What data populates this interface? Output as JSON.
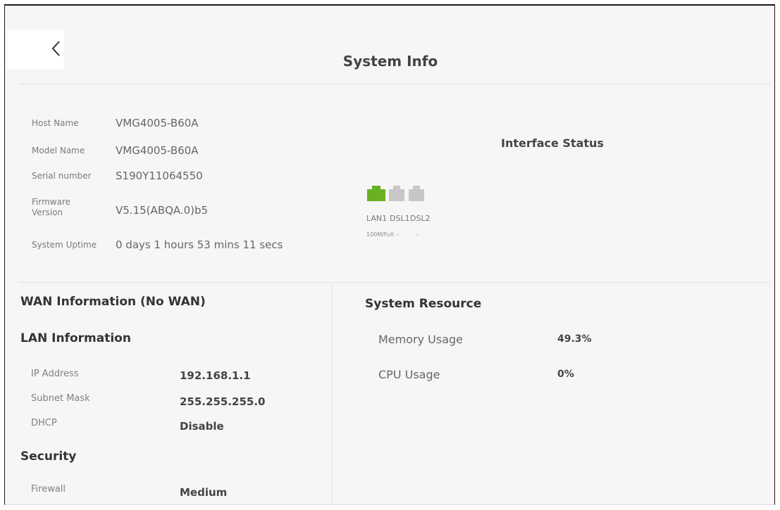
{
  "page": {
    "title": "System Info"
  },
  "system": {
    "rows": [
      {
        "label": "Host Name",
        "value": "VMG4005-B60A"
      },
      {
        "label": "Model Name",
        "value": "VMG4005-B60A"
      },
      {
        "label": "Serial number",
        "value": "S190Y11064550"
      },
      {
        "label": "Firmware Version",
        "value": "V5.15(ABQA.0)b5"
      },
      {
        "label": "System Uptime",
        "value": "0 days 1 hours 53 mins 11 secs"
      }
    ]
  },
  "interface_status": {
    "title": "Interface Status",
    "ports": [
      {
        "name": "LAN1",
        "speed": "100M/Full",
        "color": "#6ab023"
      },
      {
        "name": "DSL1",
        "speed": "-",
        "color": "#c7c7c7"
      },
      {
        "name": "DSL2",
        "speed": "-",
        "color": "#c7c7c7"
      }
    ]
  },
  "wan": {
    "title": "WAN Information (No WAN)"
  },
  "lan": {
    "title": "LAN Information",
    "rows": [
      {
        "label": "IP Address",
        "value": "192.168.1.1"
      },
      {
        "label": "Subnet Mask",
        "value": "255.255.255.0"
      },
      {
        "label": "DHCP",
        "value": "Disable"
      }
    ]
  },
  "security": {
    "title": "Security",
    "rows": [
      {
        "label": "Firewall",
        "value": "Medium"
      }
    ]
  },
  "resource": {
    "title": "System Resource",
    "rows": [
      {
        "label": "Memory Usage",
        "value": "49.3%"
      },
      {
        "label": "CPU Usage",
        "value": "0%"
      }
    ]
  }
}
